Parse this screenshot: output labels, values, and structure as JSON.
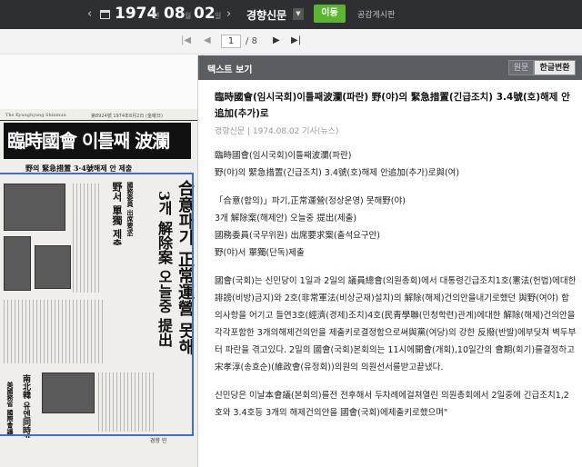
{
  "topbar": {
    "year": "1974",
    "year_unit": "년",
    "month": "08",
    "month_unit": "월",
    "day": "02",
    "day_unit": "일",
    "newspaper": "경향신문",
    "go_label": "이동",
    "board_label": "공감게시판",
    "prev_arrow": "‹",
    "next_arrow": "›"
  },
  "pagination": {
    "first": "|◀",
    "prev": "◀",
    "current": "1",
    "separator": "/",
    "total": "8",
    "next": "▶",
    "last": "▶|"
  },
  "scan": {
    "masthead": "The Kyunghyang Shinmun",
    "dateline": "第8924號 1974年8月2日 (金曜日)",
    "headline": "臨時國會 이틀째 波瀾",
    "subhead": "野의 緊急措置 3·4號해제 안 제출",
    "vertical_big": "合意파기 正常運營 못해",
    "vertical_mid": "3개 解除案 오늘중 提出",
    "vertical_small": "國務委員 出席要求案",
    "vertical_small2": "野서 單獨 제출",
    "side_head1": "南北韓 유엔同時가입 支持",
    "side_head2": "美國務省 國際會議",
    "footer": "경향 민"
  },
  "text_panel": {
    "title": "텍스트 보기",
    "tab_original": "원문",
    "tab_hangul": "한글변환",
    "article_title": "臨時國會(임시국회)이틀째波瀾(파란) 野(야)의 緊急措置(긴급조치) 3.4號(호)해제 안追加(추가)로",
    "meta": "경향신문 | 1974.08.02 기사(뉴스)",
    "lines_block1": [
      "臨時國會(임시국회)이틀째波瀾(파란)",
      "野(야)의 緊急措置(긴급조치) 3.4號(호)해제 안追加(추가)로與(여)"
    ],
    "lines_block2": [
      "「合意(합의)」파기,正常運營(정상운영) 못해野(야)",
      "3개 解除案(해제안) 오늘중 提出(제출)",
      "國務委員(국무위원) 出席要求案(출석요구안)",
      "野(야)서 單獨(단독)제출"
    ],
    "paragraph1": "國會(국회)는 신민당이 1일과 2일의 議員總會(의원총회)에서 대통령긴급조치1호(憲法(헌법)에대한 誹謗(비방)금지)와 2호(非常軍法(비상군재)설치)의 解除(해제)건의안을내기로했던 與野(여야) 합의사항을 어기고 들연3호(經濟(경제)조치)4호(民靑學聯(민청학련)관계)에대한 解除(해제)건의안을 각각포함한 3개의해제건의안을 제출키로결정함으로써與黨(여당)의 강한 反撥(반발)에부딪쳐 벽두부터 파란을 겪고있다. 2일의 國會(국회)본회의는 11시에開會(개회),10일간의 會期(회기)를결정하고 宋孝淳(송효순)(維政會(유정회))의원의 의원선서를받고끝냈다.",
    "paragraph2": "신민당은 이날本會議(본회의)를전 전후해서 두차례에걸쳐열린 의원총회에서 2일중에 긴급조치1,2호와 3.4호등 3개의 해제건의안을 國會(국회)에제출키로했으며\""
  }
}
